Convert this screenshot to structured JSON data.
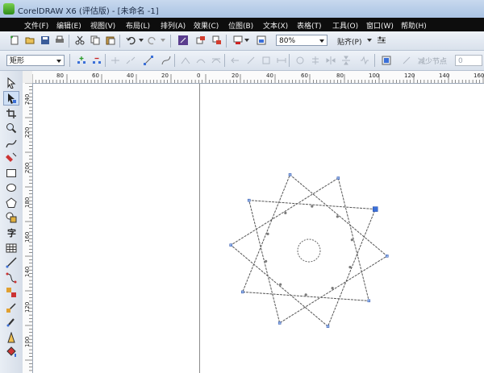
{
  "window": {
    "title": "CorelDRAW X6 (评估版) - [未命名 -1]"
  },
  "menu": [
    "文件(F)",
    "编辑(E)",
    "视图(V)",
    "布局(L)",
    "排列(A)",
    "效果(C)",
    "位图(B)",
    "文本(X)",
    "表格(T)",
    "工具(O)",
    "窗口(W)",
    "帮助(H)"
  ],
  "toolbar": {
    "zoom_value": "80%",
    "snap_label": "贴齐(P)"
  },
  "property_bar": {
    "object_type": "矩形",
    "reduce_nodes_label": "减少节点",
    "reduce_nodes_value": "0"
  },
  "ruler": {
    "h_labels": [
      "80",
      "60",
      "40",
      "20",
      "0",
      "20",
      "40",
      "60",
      "80",
      "100",
      "120",
      "140",
      "160"
    ],
    "v_labels": [
      "240",
      "220",
      "200",
      "180",
      "160",
      "140",
      "120",
      "100"
    ]
  },
  "icons": {
    "new": "new-document-icon",
    "open": "open-folder-icon",
    "save": "save-icon",
    "print": "print-icon",
    "cut": "cut-icon",
    "copy": "copy-icon",
    "paste": "paste-icon",
    "undo": "undo-icon",
    "redo": "redo-icon",
    "search": "search-content-icon",
    "import": "import-icon",
    "export": "export-icon",
    "publish": "publish-pdf-icon",
    "launcher": "app-launcher-icon",
    "options": "options-icon"
  },
  "colors": {
    "menu_bg": "#0d0d0d",
    "selection": "#3a6fd8",
    "canvas": "#ffffff"
  }
}
